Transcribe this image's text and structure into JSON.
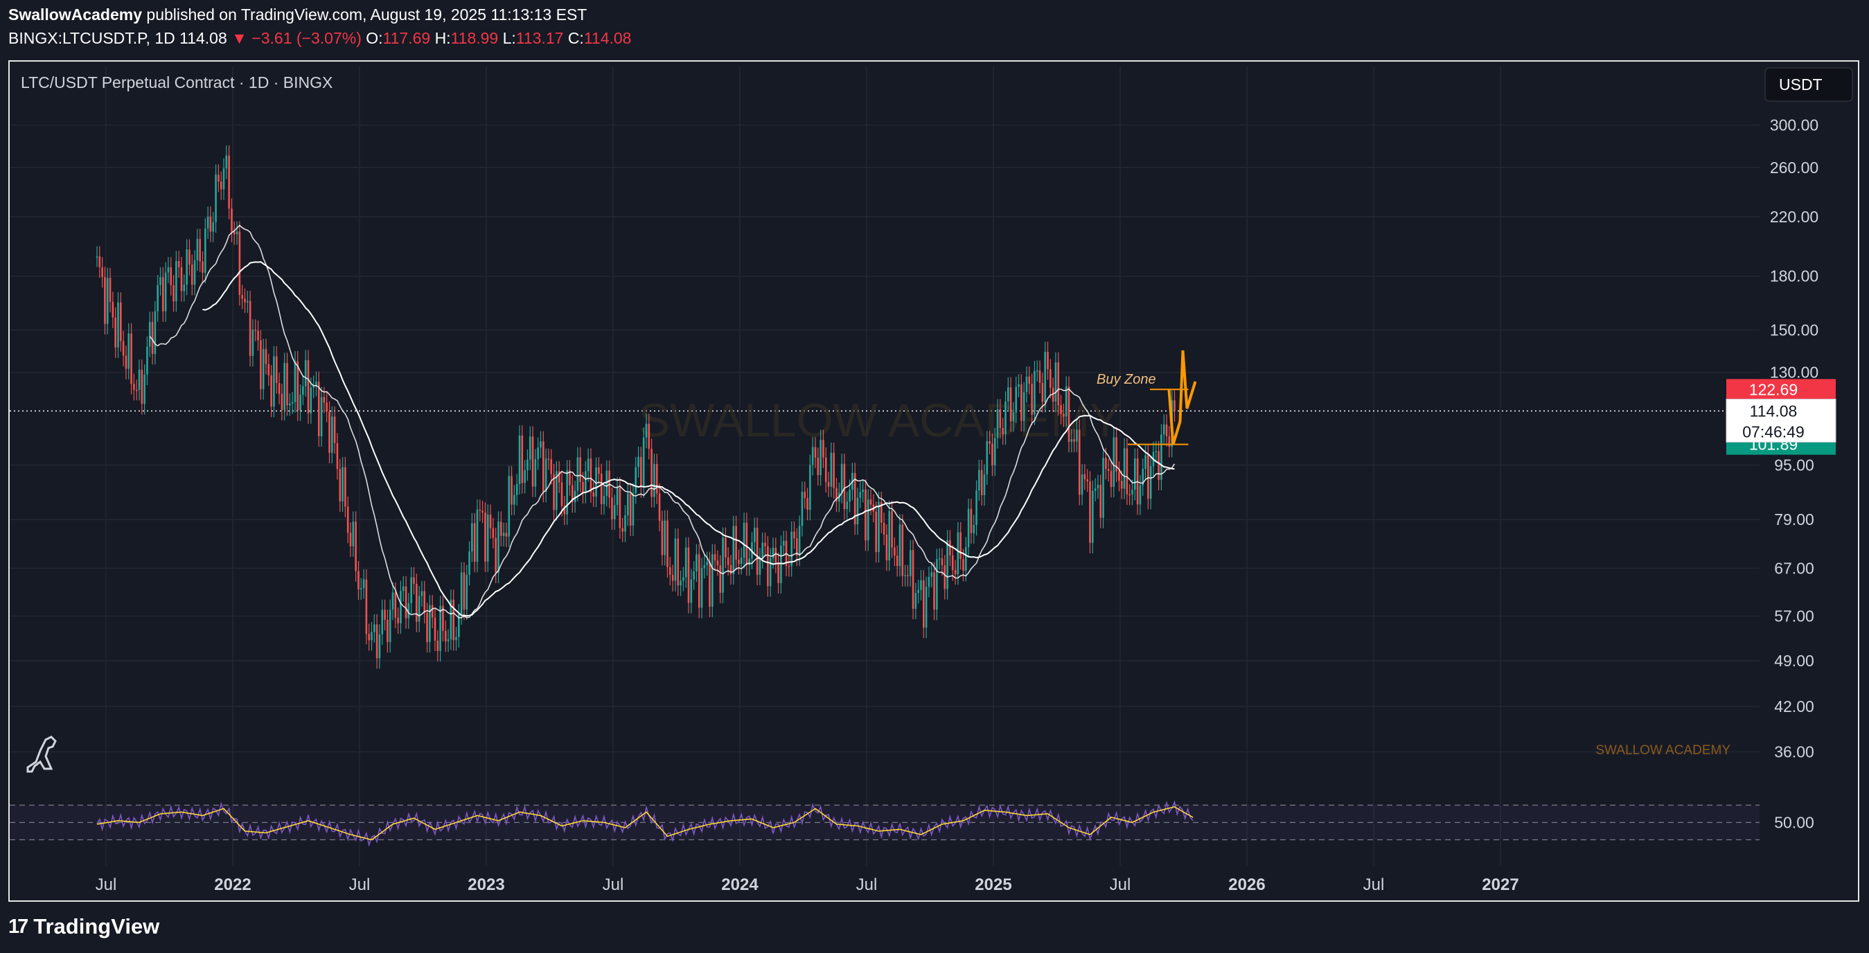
{
  "header": {
    "author": "SwallowAcademy",
    "published_text": "published on TradingView.com, August 19, 2025 11:13:13 EST",
    "symbol": "BINGX:LTCUSDT.P, 1D",
    "last": "114.08",
    "change": "▼ −3.61 (−3.07%)",
    "o_label": "O:",
    "o_value": "117.69",
    "h_label": "H:",
    "h_value": "118.99",
    "l_label": "L:",
    "l_value": "113.17",
    "c_label": "C:",
    "c_value": "114.08"
  },
  "chart_title": "LTC/USDT Perpetual Contract · 1D · BINGX",
  "currency_button": "USDT",
  "watermark": "SWALLOW ACADEMY",
  "watermark_small": "SWALLOW ACADEMY",
  "annotation": "Buy Zone",
  "footer_brand": "TradingView",
  "colors": {
    "background": "#161a25",
    "up": "#26a69a",
    "down": "#ef5350",
    "ma": "#ffffff",
    "ma_fast_up": "#22c55e",
    "ma_fast_down": "#ef5350",
    "rsi": "#7e57c2",
    "rsi_ma": "#fdd835",
    "projection": "#ff9800",
    "price_tag_red": "#f23645",
    "price_tag_green": "#089981"
  },
  "chart_data": {
    "type": "line",
    "scale": "log",
    "x_ticks": [
      "Jul",
      "2022",
      "Jul",
      "2023",
      "Jul",
      "2024",
      "Jul",
      "2025",
      "Jul",
      "2026",
      "Jul",
      "2027"
    ],
    "y_ticks": [
      "300.00",
      "260.00",
      "220.00",
      "180.00",
      "150.00",
      "130.00",
      "95.00",
      "79.00",
      "67.00",
      "57.00",
      "49.00",
      "42.00",
      "36.00"
    ],
    "ylim": [
      34,
      330
    ],
    "price_tags": {
      "resistance": "122.69",
      "last": "114.08",
      "countdown": "07:46:49",
      "support": "101.89"
    },
    "series": [
      {
        "name": "LTC/USDT",
        "x": [
          "2021-05",
          "2021-06",
          "2021-07",
          "2021-08",
          "2021-09",
          "2021-10",
          "2021-11",
          "2021-12",
          "2022-01",
          "2022-02",
          "2022-03",
          "2022-04",
          "2022-05",
          "2022-06",
          "2022-07",
          "2022-08",
          "2022-09",
          "2022-10",
          "2022-11",
          "2022-12",
          "2023-01",
          "2023-02",
          "2023-03",
          "2023-04",
          "2023-05",
          "2023-06",
          "2023-07",
          "2023-08",
          "2023-09",
          "2023-10",
          "2023-11",
          "2023-12",
          "2024-01",
          "2024-02",
          "2024-03",
          "2024-04",
          "2024-05",
          "2024-06",
          "2024-07",
          "2024-08",
          "2024-09",
          "2024-10",
          "2024-11",
          "2024-12",
          "2025-01",
          "2025-02",
          "2025-03",
          "2025-04",
          "2025-05",
          "2025-06",
          "2025-07",
          "2025-08"
        ],
        "values": [
          185,
          150,
          120,
          175,
          180,
          195,
          265,
          160,
          130,
          120,
          125,
          110,
          75,
          52,
          58,
          62,
          54,
          55,
          80,
          72,
          95,
          98,
          85,
          92,
          88,
          78,
          105,
          68,
          65,
          66,
          70,
          72,
          68,
          72,
          100,
          88,
          85,
          78,
          70,
          60,
          68,
          70,
          95,
          115,
          122,
          130,
          110,
          82,
          96,
          88,
          95,
          114
        ]
      }
    ],
    "rsi": {
      "label": "50.00",
      "upper": 70,
      "lower": 30,
      "ylim": [
        20,
        80
      ],
      "values": [
        48,
        52,
        50,
        60,
        62,
        58,
        66,
        40,
        38,
        45,
        52,
        44,
        36,
        30,
        48,
        55,
        42,
        50,
        58,
        52,
        62,
        58,
        46,
        52,
        50,
        44,
        62,
        34,
        42,
        48,
        52,
        54,
        44,
        50,
        66,
        48,
        46,
        40,
        42,
        36,
        48,
        52,
        64,
        62,
        58,
        60,
        44,
        36,
        56,
        50,
        62,
        68,
        54
      ]
    }
  }
}
